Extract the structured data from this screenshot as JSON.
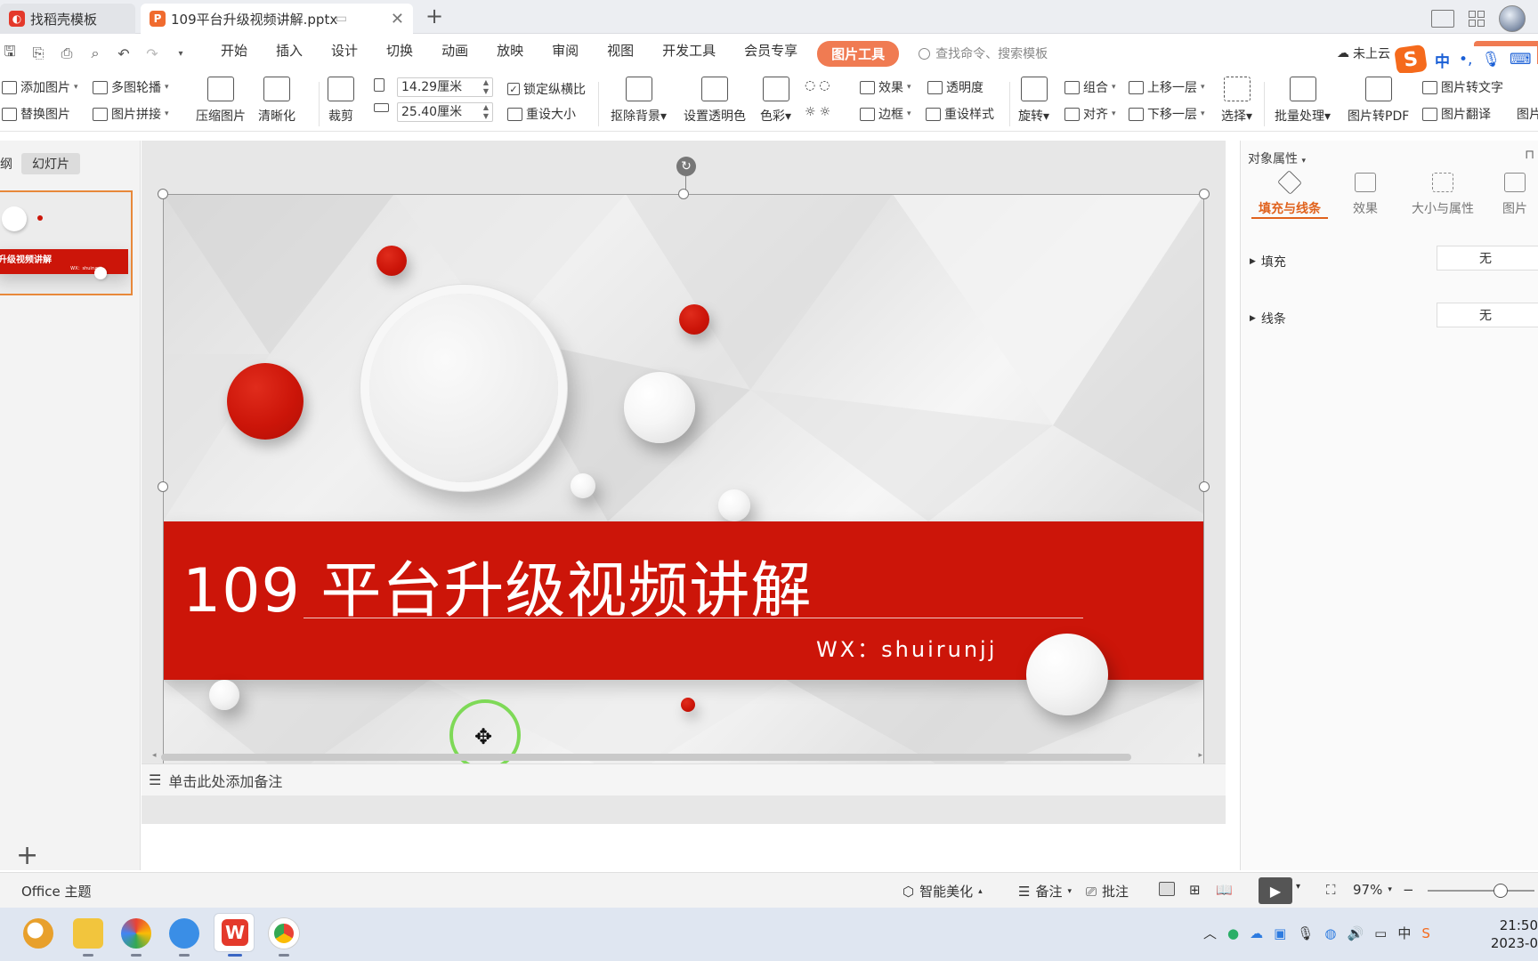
{
  "titlebar": {
    "tabs": [
      {
        "label": "找稻壳模板",
        "icon": "daoke-logo-icon"
      },
      {
        "label": "109平台升级视频讲解.pptx",
        "icon": "pptx-file-icon"
      }
    ]
  },
  "menu": {
    "items": [
      "开始",
      "插入",
      "设计",
      "切换",
      "动画",
      "放映",
      "审阅",
      "视图",
      "开发工具",
      "会员专享"
    ],
    "active": "图片工具",
    "search_placeholder": "查找命令、搜索模板",
    "cloud_status": "未上云"
  },
  "ribbon": {
    "add_picture": "添加图片",
    "multi_carousel": "多图轮播",
    "replace_picture": "替换图片",
    "picture_mosaic": "图片拼接",
    "compress": "压缩图片",
    "sharpen": "清晰化",
    "crop": "裁剪",
    "height_value": "14.29厘米",
    "width_value": "25.40厘米",
    "lock_ratio": "锁定纵横比",
    "reset_size": "重设大小",
    "remove_bg": "抠除背景",
    "set_transparent": "设置透明色",
    "color": "色彩",
    "effects": "效果",
    "transparency": "透明度",
    "border": "边框",
    "reset_style": "重设样式",
    "rotate": "旋转",
    "group": "组合",
    "align": "对齐",
    "bring_forward": "上移一层",
    "send_backward": "下移一层",
    "select": "选择",
    "batch": "批量处理",
    "to_pdf": "图片转PDF",
    "to_text": "图片转文字",
    "translate": "图片翻译",
    "more": "图片"
  },
  "left_panel": {
    "tab_outline": "纲",
    "tab_slides": "幻灯片",
    "thumb_title": "升级视频讲解",
    "thumb_sub": "WX：shuirunjj"
  },
  "slide": {
    "title": "109 平台升级视频讲解",
    "subtitle": "WX：shuirunjj"
  },
  "notes_placeholder": "单击此处添加备注",
  "right_panel": {
    "title": "对象属性",
    "tabs": [
      "填充与线条",
      "效果",
      "大小与属性",
      "图片"
    ],
    "fill_label": "填充",
    "fill_value": "无",
    "line_label": "线条",
    "line_value": "无"
  },
  "status": {
    "theme": "Office 主题",
    "beautify": "智能美化",
    "notes": "备注",
    "comments": "批注",
    "zoom": "97%"
  },
  "taskbar": {
    "time": "21:50",
    "date": "2023-0"
  },
  "colors": {
    "accent": "#f07b52",
    "slide_red": "#cc1509",
    "selection_orange": "#e8883a"
  }
}
